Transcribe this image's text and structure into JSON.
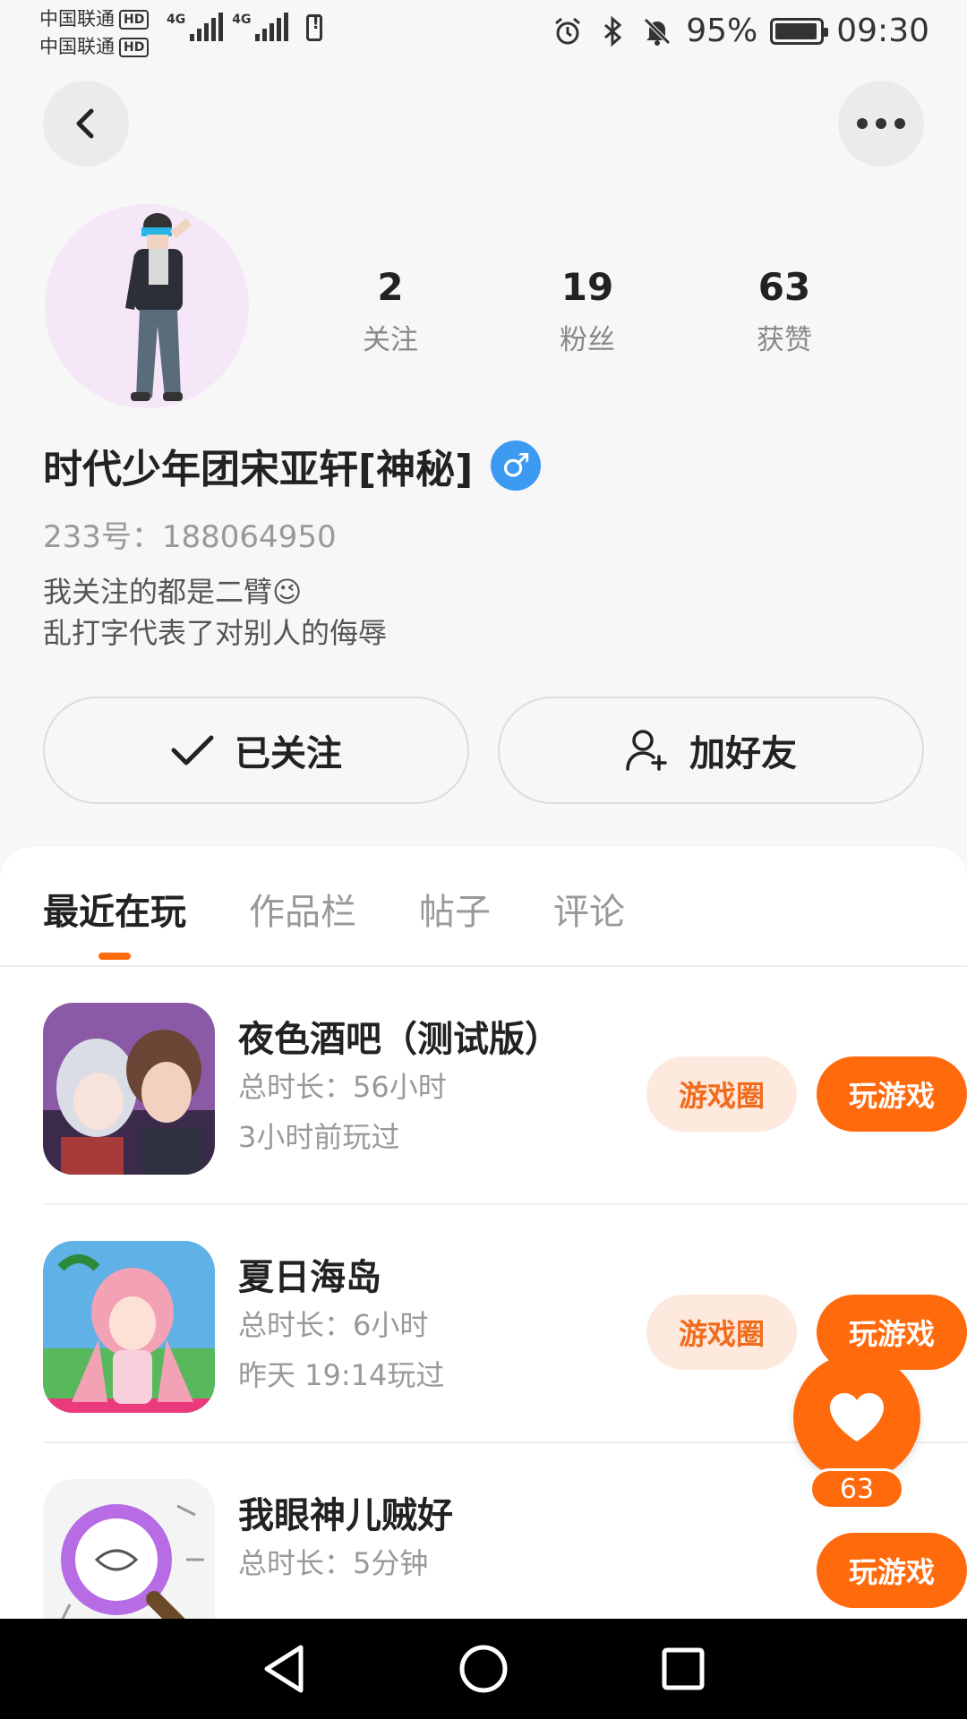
{
  "status_bar": {
    "carrier1": "中国联通",
    "carrier2": "中国联通",
    "hd_label": "HD",
    "network1": "4G",
    "network2": "4G",
    "battery_percent": "95%",
    "time": "09:30",
    "battery_level": 0.95
  },
  "profile": {
    "stats": [
      {
        "value": "2",
        "label": "关注"
      },
      {
        "value": "19",
        "label": "粉丝"
      },
      {
        "value": "63",
        "label": "获赞"
      }
    ],
    "nickname": "时代少年团宋亚轩[神秘]",
    "gender_symbol": "♂",
    "uid_text": "233号：188064950",
    "bio_line1": "我关注的都是二臂😉",
    "bio_line2": "乱打字代表了对别人的侮辱"
  },
  "actions": {
    "follow_label": "已关注",
    "add_friend_label": "加好友"
  },
  "tabs": [
    "最近在玩",
    "作品栏",
    "帖子",
    "评论"
  ],
  "games": [
    {
      "name": "夜色酒吧（测试版）",
      "total_time": "总时长：56小时",
      "last_played": "3小时前玩过",
      "circle_label": "游戏圈",
      "play_label": "玩游戏"
    },
    {
      "name": "夏日海岛",
      "total_time": "总时长：6小时",
      "last_played": "昨天 19:14玩过",
      "circle_label": "游戏圈",
      "play_label": "玩游戏"
    },
    {
      "name": "我眼神儿贼好",
      "total_time": "总时长：5分钟",
      "last_played": "",
      "play_label": "玩游戏"
    }
  ],
  "like_fab": {
    "count": "63"
  },
  "colors": {
    "accent": "#ff6a0d",
    "chip_bg": "#fde9dd",
    "gender_blue": "#3d9af1"
  }
}
